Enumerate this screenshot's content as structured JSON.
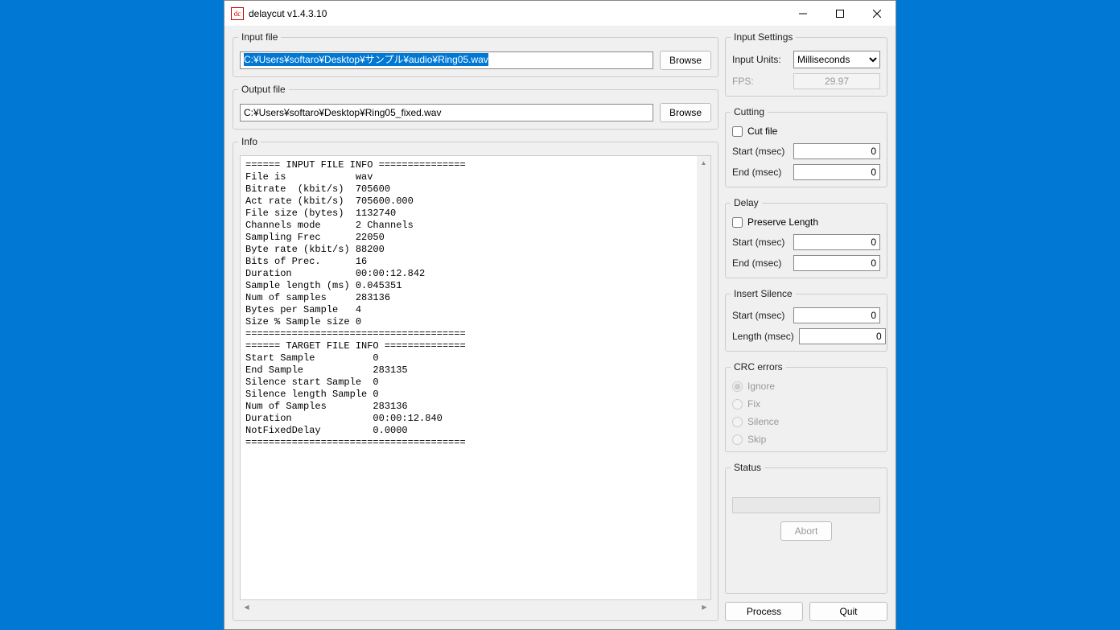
{
  "titlebar": {
    "icon_text": "dc",
    "title": "delaycut v1.4.3.10"
  },
  "input_file": {
    "legend": "Input file",
    "value": "C:¥Users¥softaro¥Desktop¥サンプル¥audio¥Ring05.wav",
    "browse": "Browse"
  },
  "output_file": {
    "legend": "Output file",
    "value": "C:¥Users¥softaro¥Desktop¥Ring05_fixed.wav",
    "browse": "Browse"
  },
  "info": {
    "legend": "Info",
    "text": "====== INPUT FILE INFO ===============\nFile is            wav\nBitrate  (kbit/s)  705600\nAct rate (kbit/s)  705600.000\nFile size (bytes)  1132740\nChannels mode      2 Channels\nSampling Frec      22050\nByte rate (kbit/s) 88200\nBits of Prec.      16\nDuration           00:00:12.842\nSample length (ms) 0.045351\nNum of samples     283136\nBytes per Sample   4\nSize % Sample size 0\n======================================\n====== TARGET FILE INFO ==============\nStart Sample          0\nEnd Sample            283135\nSilence start Sample  0\nSilence length Sample 0\nNum of Samples        283136\nDuration              00:00:12.840\nNotFixedDelay         0.0000\n======================================"
  },
  "input_settings": {
    "legend": "Input Settings",
    "units_label": "Input Units:",
    "units_value": "Milliseconds",
    "fps_label": "FPS:",
    "fps_value": "29.97"
  },
  "cutting": {
    "legend": "Cutting",
    "cutfile_label": "Cut file",
    "start_label": "Start (msec)",
    "start_value": "0",
    "end_label": "End (msec)",
    "end_value": "0"
  },
  "delay": {
    "legend": "Delay",
    "preserve_label": "Preserve Length",
    "start_label": "Start (msec)",
    "start_value": "0",
    "end_label": "End (msec)",
    "end_value": "0"
  },
  "silence": {
    "legend": "Insert Silence",
    "start_label": "Start (msec)",
    "start_value": "0",
    "length_label": "Length (msec)",
    "length_value": "0"
  },
  "crc": {
    "legend": "CRC errors",
    "options": [
      "Ignore",
      "Fix",
      "Silence",
      "Skip"
    ]
  },
  "status": {
    "legend": "Status",
    "abort": "Abort"
  },
  "buttons": {
    "process": "Process",
    "quit": "Quit"
  }
}
